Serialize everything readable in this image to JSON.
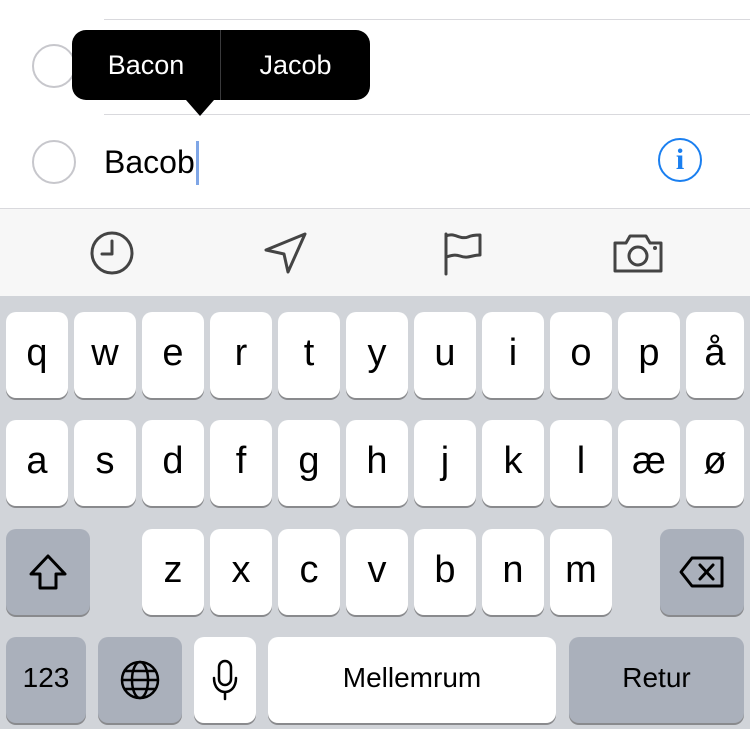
{
  "reminder": {
    "text": "Bacob",
    "info_icon": "info-icon",
    "info_glyph": "i"
  },
  "autocorrect_popup": {
    "suggestions": [
      "Bacon",
      "Jacob"
    ]
  },
  "toolbar": {
    "icons": [
      "clock-icon",
      "location-arrow-icon",
      "flag-icon",
      "camera-icon"
    ]
  },
  "keyboard": {
    "row1": [
      "q",
      "w",
      "e",
      "r",
      "t",
      "y",
      "u",
      "i",
      "o",
      "p",
      "å"
    ],
    "row2": [
      "a",
      "s",
      "d",
      "f",
      "g",
      "h",
      "j",
      "k",
      "l",
      "æ",
      "ø"
    ],
    "row3": [
      "z",
      "x",
      "c",
      "v",
      "b",
      "n",
      "m"
    ],
    "shift_icon": "shift-icon",
    "delete_icon": "backspace-icon",
    "numbers_label": "123",
    "globe_icon": "globe-icon",
    "mic_icon": "microphone-icon",
    "space_label": "Mellemrum",
    "return_label": "Retur"
  },
  "colors": {
    "accent": "#1a7ff0",
    "keyboard_bg": "#d1d4d9",
    "dark_key": "#aab0bb",
    "caret": "#7fa6e6"
  }
}
